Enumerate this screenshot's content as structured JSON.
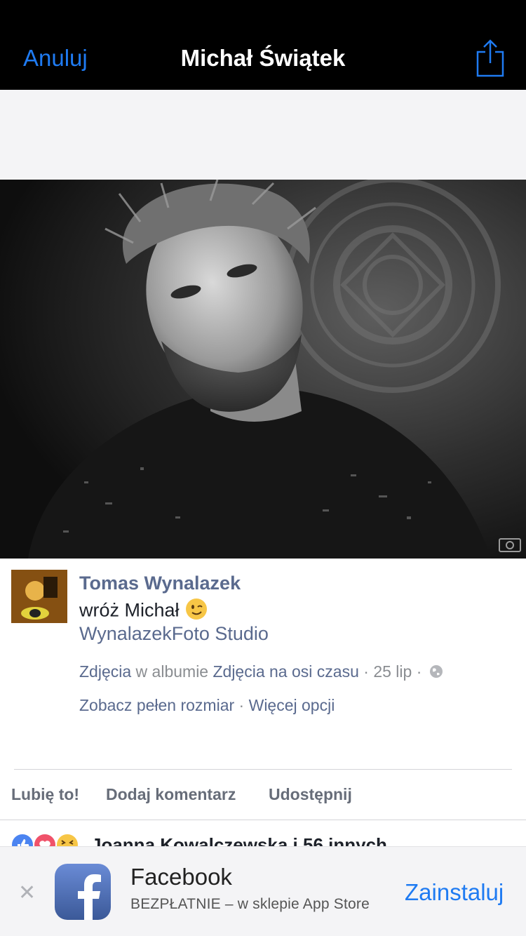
{
  "navbar": {
    "cancel_label": "Anuluj",
    "title": "Michał Świątek",
    "share_icon": "share-icon"
  },
  "post": {
    "author": "Tomas Wynalazek",
    "caption": "wróż Michał",
    "caption_emoji": "winking-face-emoji",
    "page_name": "WynalazekFoto Studio",
    "meta_link_photos": "Zdjęcia",
    "meta_in_album": " w albumie ",
    "meta_album_name": "Zdjęcia na osi czasu",
    "meta_date": " · 25 lip · ",
    "privacy_icon": "globe-icon",
    "full_size_label": "Zobacz pełen rozmiar",
    "separator": " · ",
    "more_options_label": "Więcej opcji"
  },
  "actions": {
    "like": "Lubię to!",
    "comment": "Dodaj komentarz",
    "share": "Udostępnij"
  },
  "reactions": {
    "icons": [
      "like-reaction-icon",
      "love-reaction-icon",
      "haha-reaction-icon"
    ],
    "summary": "Joanna Kowalczewska i 56 innych"
  },
  "app_banner": {
    "close_icon": "close-icon",
    "app_name": "Facebook",
    "subtitle": "BEZPŁATNIE – w sklepie App Store",
    "install_label": "Zainstaluj",
    "logo_icon": "facebook-logo-icon"
  },
  "colors": {
    "ios_blue": "#1f7bf2",
    "fb_link": "#5a6a8e",
    "fb_blue": "#3b5998"
  }
}
